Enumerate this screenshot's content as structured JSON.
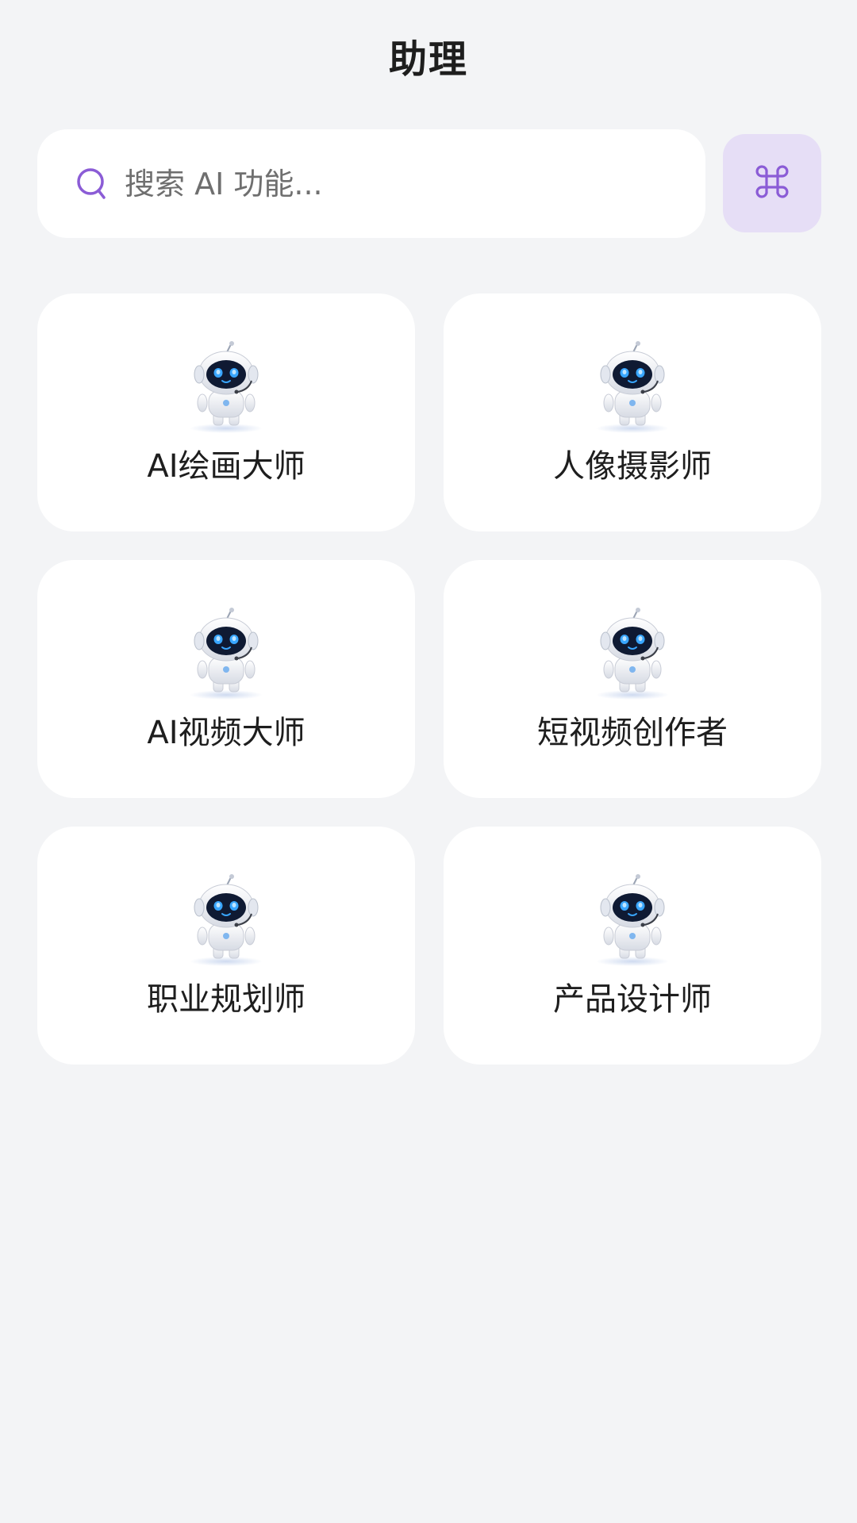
{
  "header": {
    "title": "助理"
  },
  "search": {
    "placeholder": "搜索 AI 功能...",
    "value": "",
    "icon": "search-icon"
  },
  "command_button": {
    "icon": "command-icon"
  },
  "assistants": [
    {
      "label": "AI绘画大师",
      "avatar": "robot-avatar"
    },
    {
      "label": "人像摄影师",
      "avatar": "robot-avatar"
    },
    {
      "label": "AI视频大师",
      "avatar": "robot-avatar"
    },
    {
      "label": "短视频创作者",
      "avatar": "robot-avatar"
    },
    {
      "label": "职业规划师",
      "avatar": "robot-avatar"
    },
    {
      "label": "产品设计师",
      "avatar": "robot-avatar"
    }
  ],
  "colors": {
    "background": "#f3f4f6",
    "accent": "#8b5cd6",
    "accent_bg": "#e6def6",
    "card": "#ffffff"
  }
}
